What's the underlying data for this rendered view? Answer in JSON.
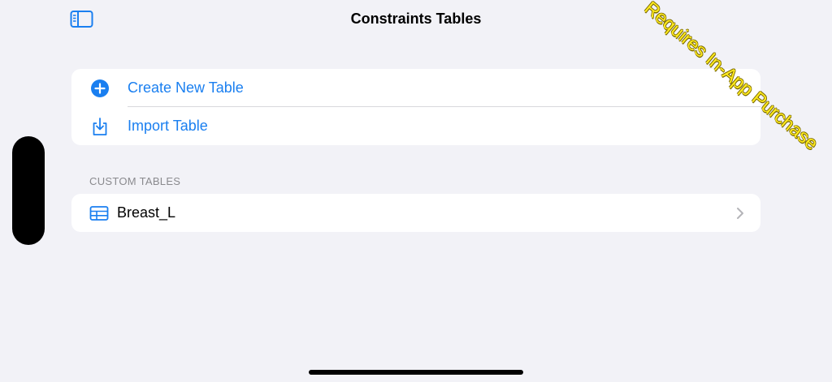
{
  "nav": {
    "title": "Constraints Tables"
  },
  "actions": [
    {
      "label": "Create New Table",
      "icon": "plus-circle-icon"
    },
    {
      "label": "Import Table",
      "icon": "import-icon"
    }
  ],
  "custom_tables": {
    "header": "CUSTOM TABLES",
    "items": [
      {
        "label": "Breast_L",
        "icon": "table-icon"
      }
    ]
  },
  "watermark": {
    "text": "Requires In-App Purchase"
  },
  "colors": {
    "accent": "#1a7ff0",
    "background": "#f2f2f7",
    "watermark": "#ffea1f"
  }
}
